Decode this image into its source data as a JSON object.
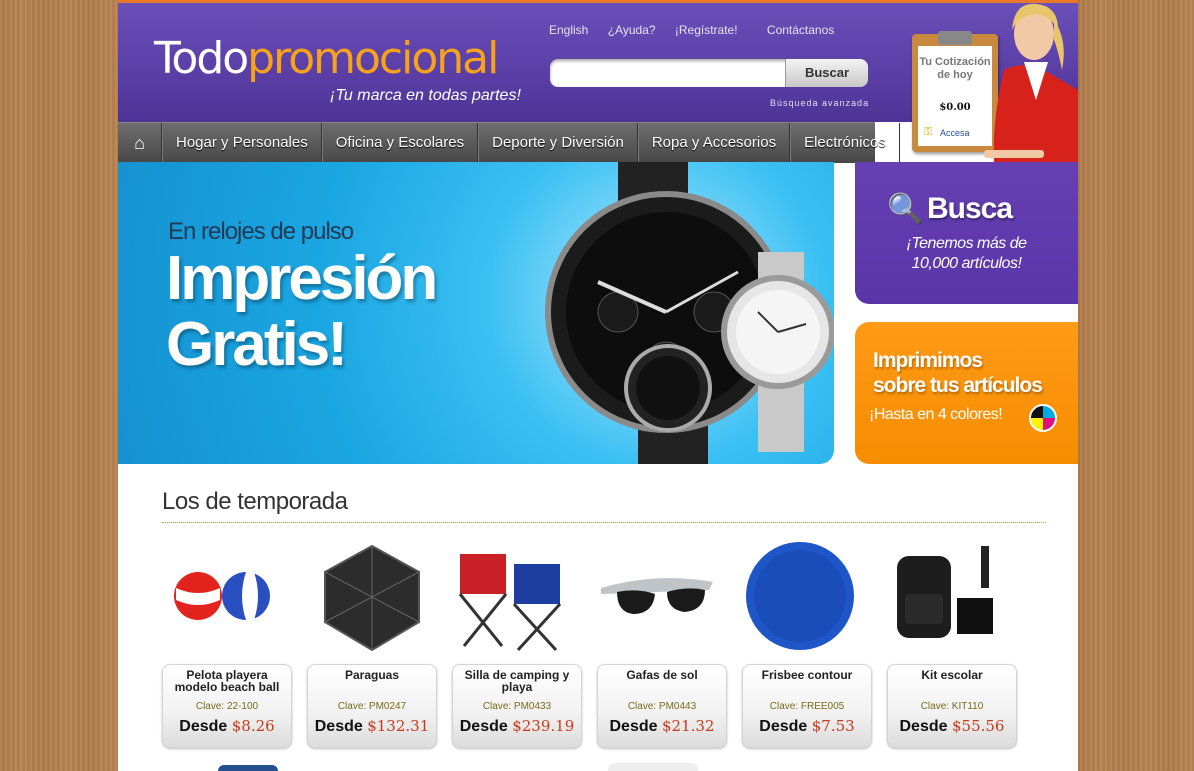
{
  "header": {
    "logo_part1": "Todo",
    "logo_part2": "promocional",
    "tagline": "¡Tu marca en todas partes!",
    "links": [
      "English",
      "¿Ayuda?",
      "¡Regístrate!",
      "Contáctanos"
    ],
    "search": {
      "placeholder": "",
      "button": "Buscar"
    },
    "advanced_search": "Búsqueda avanzada",
    "quote": {
      "title": "Tu Cotización de hoy",
      "amount": "$0.00",
      "link": "Accesa"
    }
  },
  "nav": {
    "home_icon": "home-icon",
    "items": [
      "Hogar y Personales",
      "Oficina y Escolares",
      "Deporte y Diversión",
      "Ropa y Accesorios",
      "Electrónicos"
    ]
  },
  "hero": {
    "line1": "En relojes de pulso",
    "line2": "Impresión",
    "line3": "Gratis!"
  },
  "side_busca": {
    "title": "Busca",
    "line1": "¡Tenemos más de",
    "line2": "10,000 artículos!"
  },
  "side_imprimimos": {
    "line1": "Imprimimos",
    "line2": "sobre tus artículos",
    "line3": "¡Hasta en 4 colores!"
  },
  "products_section": {
    "title": "Los de temporada",
    "items": [
      {
        "name": "Pelota playera modelo beach ball",
        "clave": "Clave: 22-100",
        "desde": "Desde",
        "price": "$8.26"
      },
      {
        "name": "Paraguas",
        "clave": "Clave: PM0247",
        "desde": "Desde",
        "price": "$132.31"
      },
      {
        "name": "Silla de camping y playa",
        "clave": "Clave: PM0433",
        "desde": "Desde",
        "price": "$239.19"
      },
      {
        "name": "Gafas de sol",
        "clave": "Clave: PM0443",
        "desde": "Desde",
        "price": "$21.32"
      },
      {
        "name": "Frisbee contour",
        "clave": "Clave: FREE005",
        "desde": "Desde",
        "price": "$7.53"
      },
      {
        "name": "Kit escolar",
        "clave": "Clave: KIT110",
        "desde": "Desde",
        "price": "$55.56"
      }
    ]
  },
  "colors": {
    "header_purple": "#5a3ea6",
    "accent_orange": "#f68d00",
    "price_red": "#c63a1a",
    "hero_blue": "#1aa6e2"
  }
}
